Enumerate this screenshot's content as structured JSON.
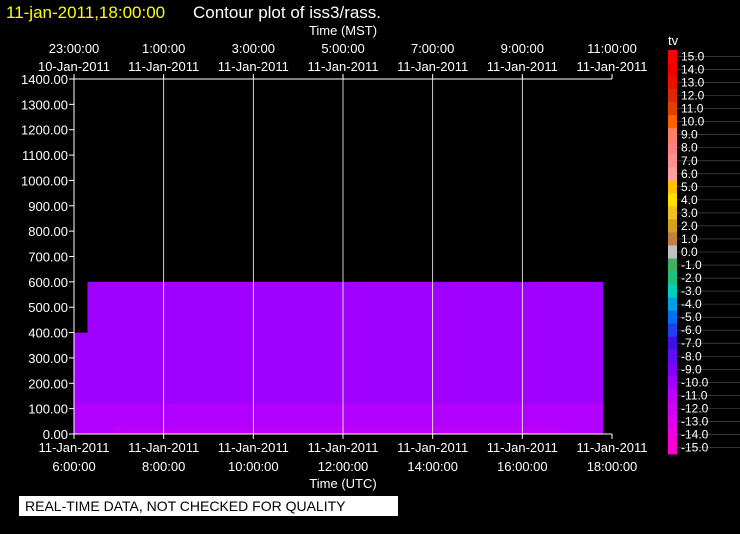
{
  "header": {
    "timestamp": "11-jan-2011,18:00:00",
    "title": "Contour plot of iss3/rass."
  },
  "banner": "REAL-TIME DATA, NOT CHECKED FOR QUALITY",
  "chart_data": {
    "type": "heatmap",
    "top_axis": {
      "label": "Time (MST)",
      "ticks": [
        {
          "time": "23:00:00",
          "date": "10-Jan-2011"
        },
        {
          "time": "1:00:00",
          "date": "11-Jan-2011"
        },
        {
          "time": "3:00:00",
          "date": "11-Jan-2011"
        },
        {
          "time": "5:00:00",
          "date": "11-Jan-2011"
        },
        {
          "time": "7:00:00",
          "date": "11-Jan-2011"
        },
        {
          "time": "9:00:00",
          "date": "11-Jan-2011"
        },
        {
          "time": "11:00:00",
          "date": "11-Jan-2011"
        }
      ]
    },
    "bottom_axis": {
      "label": "Time (UTC)",
      "ticks": [
        {
          "date": "11-Jan-2011",
          "time": "6:00:00"
        },
        {
          "date": "11-Jan-2011",
          "time": "8:00:00"
        },
        {
          "date": "11-Jan-2011",
          "time": "10:00:00"
        },
        {
          "date": "11-Jan-2011",
          "time": "12:00:00"
        },
        {
          "date": "11-Jan-2011",
          "time": "14:00:00"
        },
        {
          "date": "11-Jan-2011",
          "time": "16:00:00"
        },
        {
          "date": "11-Jan-2011",
          "time": "18:00:00"
        }
      ],
      "range_hours_utc": [
        6,
        18
      ]
    },
    "y_axis": {
      "ticks": [
        "0.00",
        "100.00",
        "200.00",
        "300.00",
        "400.00",
        "500.00",
        "600.00",
        "700.00",
        "800.00",
        "900.00",
        "1000.00",
        "1100.00",
        "1200.00",
        "1300.00",
        "1400.00"
      ],
      "range": [
        0,
        1400
      ]
    },
    "colorbar": {
      "label": "tv",
      "levels": [
        "15.0",
        "14.0",
        "13.0",
        "12.0",
        "11.0",
        "10.0",
        "9.0",
        "8.0",
        "7.0",
        "6.0",
        "5.0",
        "4.0",
        "3.0",
        "2.0",
        "1.0",
        "0.0",
        "-1.0",
        "-2.0",
        "-3.0",
        "-4.0",
        "-5.0",
        "-6.0",
        "-7.0",
        "-8.0",
        "-9.0",
        "-10.0",
        "-11.0",
        "-12.0",
        "-13.0",
        "-14.0",
        "-15.0"
      ],
      "colors": [
        "#ff0000",
        "#f00000",
        "#e81000",
        "#e02800",
        "#e04000",
        "#ff6000",
        "#ff8060",
        "#ff8080",
        "#ff9090",
        "#ffa0a0",
        "#ffc000",
        "#ffe000",
        "#f0c020",
        "#d8a020",
        "#c08040",
        "#c0c0c0",
        "#40b060",
        "#20c080",
        "#00d0c0",
        "#00a0e0",
        "#0070f0",
        "#2040f0",
        "#4010e0",
        "#6010f0",
        "#8000ff",
        "#a000ff",
        "#c000ff",
        "#d000f0",
        "#e000f0",
        "#f000e0",
        "#ff00d0"
      ]
    },
    "field": {
      "dominant_level": "-10.0",
      "dominant_color": "#a000ff",
      "data_start_hour_utc": 6.3,
      "data_end_hour_utc": 17.8,
      "data_top_height": 600,
      "first_profile_top_height": 400
    },
    "grid": "vertical"
  }
}
